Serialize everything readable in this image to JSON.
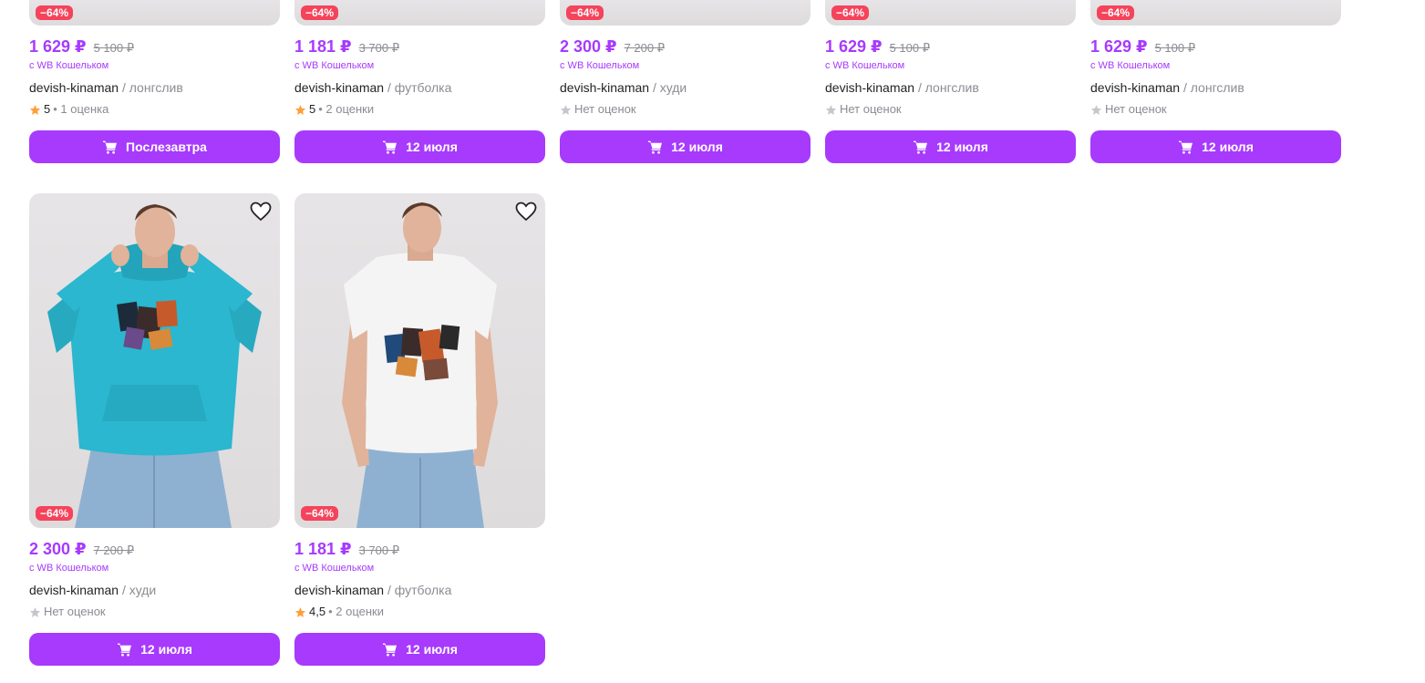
{
  "colors": {
    "accent": "#a73afd",
    "badge": "#f5435b",
    "star_filled": "#ff9f3a",
    "star_empty": "#c6c6cc",
    "hoodie": "#2ab7cf",
    "tshirt": "#f4f4f4",
    "jeans": "#8fb1d1"
  },
  "icons": {
    "favorite": "heart-icon",
    "cart": "cart-icon",
    "rating": "star-icon"
  },
  "products": [
    {
      "discount": "−64%",
      "price": "1 629 ₽",
      "old_price": "5 100 ₽",
      "wallet": "с WB Кошельком",
      "brand": "devish-kinaman",
      "category": "/ лонгслив",
      "rating": "5",
      "reviews": "• 1 оценка",
      "no_rating": "",
      "delivery": "Послезавтра"
    },
    {
      "discount": "−64%",
      "price": "1 181 ₽",
      "old_price": "3 700 ₽",
      "wallet": "с WB Кошельком",
      "brand": "devish-kinaman",
      "category": "/ футболка",
      "rating": "5",
      "reviews": "• 2 оценки",
      "no_rating": "",
      "delivery": "12 июля"
    },
    {
      "discount": "−64%",
      "price": "2 300 ₽",
      "old_price": "7 200 ₽",
      "wallet": "с WB Кошельком",
      "brand": "devish-kinaman",
      "category": "/ худи",
      "rating": "",
      "reviews": "",
      "no_rating": "Нет оценок",
      "delivery": "12 июля"
    },
    {
      "discount": "−64%",
      "price": "1 629 ₽",
      "old_price": "5 100 ₽",
      "wallet": "с WB Кошельком",
      "brand": "devish-kinaman",
      "category": "/ лонгслив",
      "rating": "",
      "reviews": "",
      "no_rating": "Нет оценок",
      "delivery": "12 июля"
    },
    {
      "discount": "−64%",
      "price": "1 629 ₽",
      "old_price": "5 100 ₽",
      "wallet": "с WB Кошельком",
      "brand": "devish-kinaman",
      "category": "/ лонгслив",
      "rating": "",
      "reviews": "",
      "no_rating": "Нет оценок",
      "delivery": "12 июля"
    },
    {
      "discount": "−64%",
      "price": "2 300 ₽",
      "old_price": "7 200 ₽",
      "wallet": "с WB Кошельком",
      "brand": "devish-kinaman",
      "category": "/ худи",
      "rating": "",
      "reviews": "",
      "no_rating": "Нет оценок",
      "delivery": "12 июля"
    },
    {
      "discount": "−64%",
      "price": "1 181 ₽",
      "old_price": "3 700 ₽",
      "wallet": "с WB Кошельком",
      "brand": "devish-kinaman",
      "category": "/ футболка",
      "rating": "4,5",
      "reviews": "• 2 оценки",
      "no_rating": "",
      "delivery": "12 июля"
    }
  ]
}
